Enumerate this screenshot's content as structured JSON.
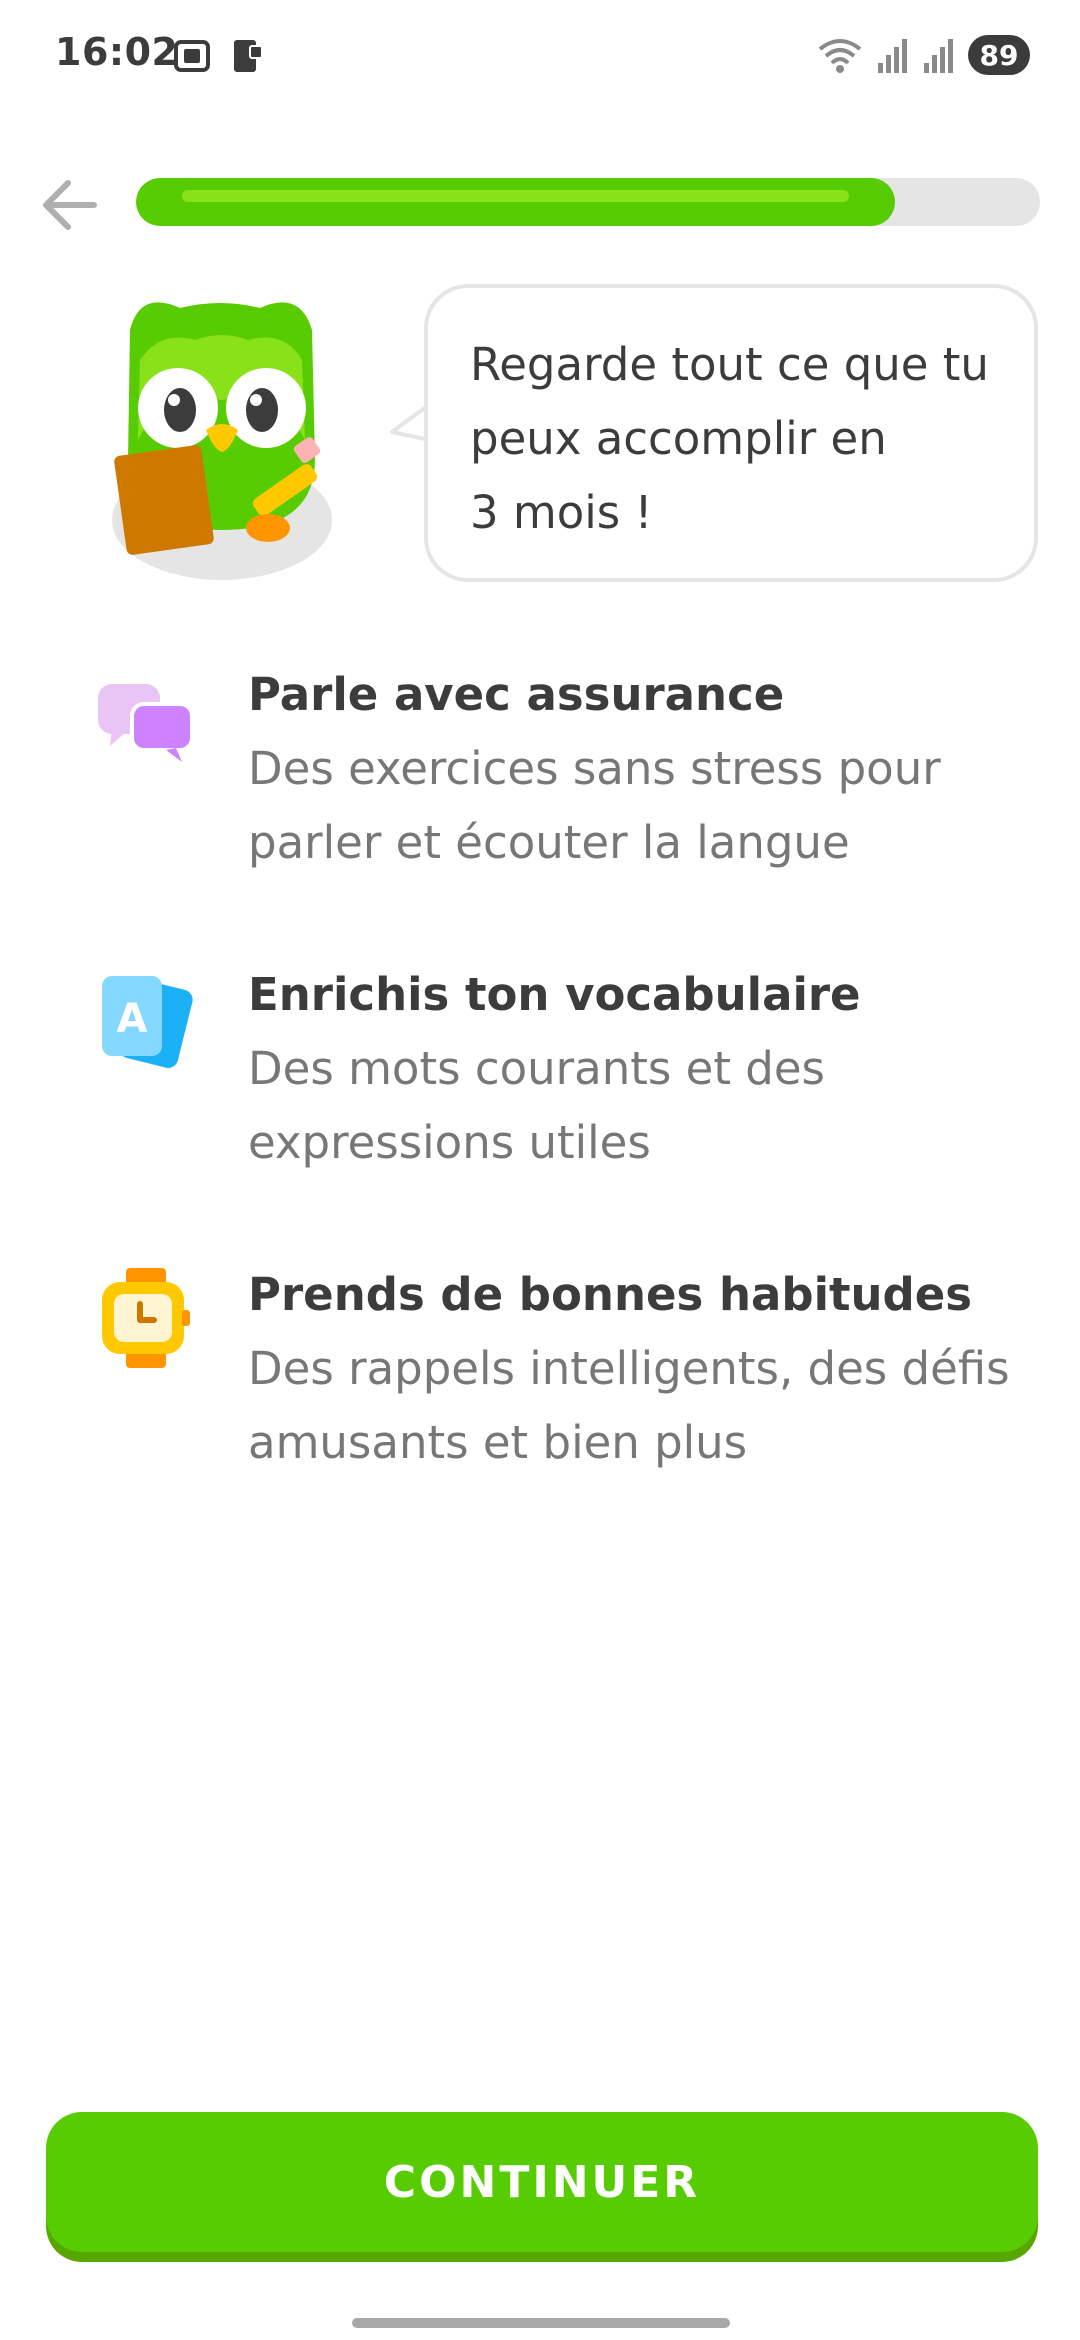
{
  "status_bar": {
    "time": "16:02",
    "battery": "89",
    "icons": [
      "screenshot-icon",
      "phone-notification-icon",
      "wifi-icon",
      "signal-icon",
      "signal-icon"
    ]
  },
  "header": {
    "back_icon": "arrow-left-icon",
    "progress": 0.84
  },
  "speech": {
    "text": "Regarde tout ce que tu\npeux accomplir en\n3 mois !"
  },
  "features": [
    {
      "icon": "chat-bubbles-icon",
      "title": "Parle avec assurance",
      "desc": "Des exercices sans stress pour parler et écouter la langue"
    },
    {
      "icon": "flashcards-icon",
      "title": "Enrichis ton vocabulaire",
      "desc": "Des mots courants et des expressions utiles"
    },
    {
      "icon": "watch-icon",
      "title": "Prends de bonnes habitudes",
      "desc": "Des rappels intelligents, des défis amusants et bien plus"
    }
  ],
  "continue_button": {
    "label": "CONTINUER"
  },
  "colors": {
    "brand_green": "#58cc02",
    "brand_green_shadow": "#58a700",
    "track_gray": "#e5e5e5"
  }
}
